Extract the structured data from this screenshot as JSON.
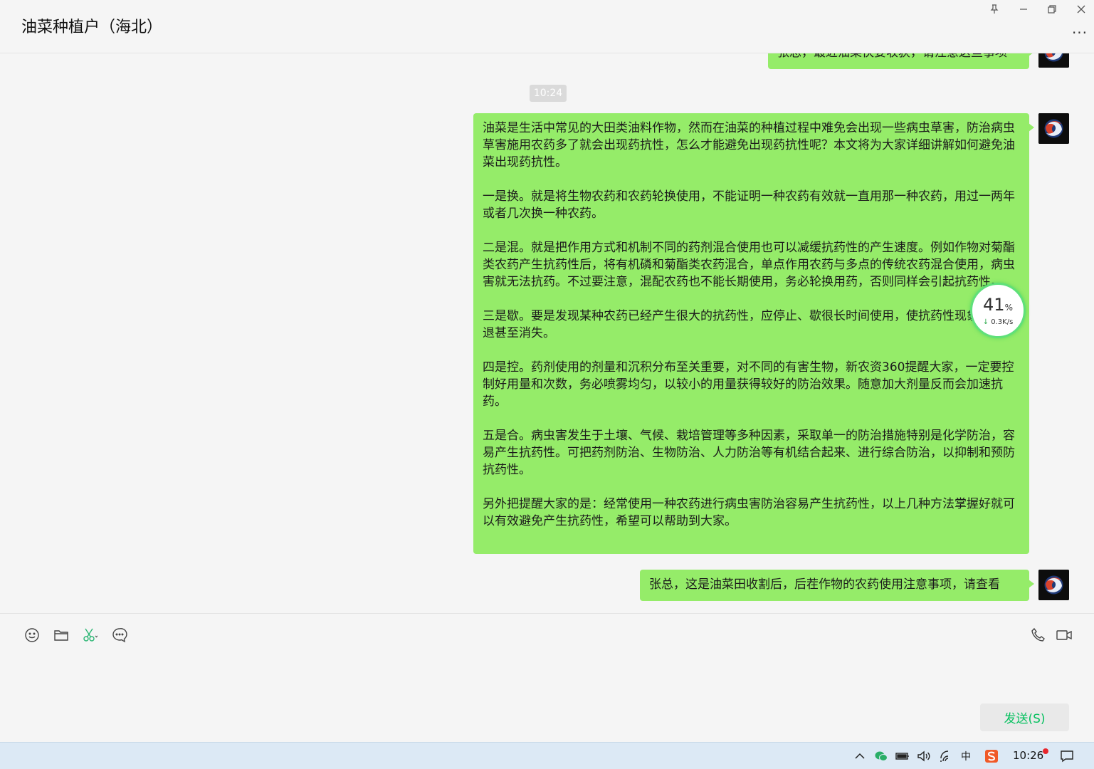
{
  "window": {
    "chat_title": "油菜种植户（海北）",
    "more_label": "···"
  },
  "messages": {
    "partial_top_text": "张总，最近油菜快要收获，请注意这些事项",
    "timestamp": "10:24",
    "long_message": "油菜是生活中常见的大田类油料作物，然而在油菜的种植过程中难免会出现一些病虫草害，防治病虫草害施用农药多了就会出现药抗性，怎么才能避免出现药抗性呢？本文将为大家详细讲解如何避免油菜出现药抗性。\n\n一是换。就是将生物农药和农药轮换使用，不能证明一种农药有效就一直用那一种农药，用过一两年或者几次换一种农药。\n\n二是混。就是把作用方式和机制不同的药剂混合使用也可以减缓抗药性的产生速度。例如作物对菊酯类农药产生抗药性后，将有机磷和菊酯类农药混合，单点作用农药与多点的传统农药混合使用，病虫害就无法抗药。不过要注意，混配农药也不能长期使用，务必轮换用药，否则同样会引起抗药性。\n\n三是歇。要是发现某种农药已经产生很大的抗药性，应停止、歇很长时间使用，使抗药性现象逐渐减退甚至消失。\n\n四是控。药剂使用的剂量和沉积分布至关重要，对不同的有害生物，新农资360提醒大家，一定要控制好用量和次数，务必喷雾均匀，以较小的用量获得较好的防治效果。随意加大剂量反而会加速抗药。\n\n五是合。病虫害发生于土壤、气候、栽培管理等多种因素，采取单一的防治措施特别是化学防治，容易产生抗药性。可把药剂防治、生物防治、人力防治等有机结合起来、进行综合防治，以抑制和预防抗药性。\n\n另外把提醒大家的是：经常使用一种农药进行病虫害防治容易产生抗药性，以上几种方法掌握好就可以有效避免产生抗药性，希望可以帮助到大家。",
    "last_message": "张总，这是油菜田收割后，后茬作物的农药使用注意事项，请查看"
  },
  "speed_widget": {
    "percent": "41",
    "percent_sign": "%",
    "rate": "0.3K/s",
    "arrow": "↓"
  },
  "input": {
    "send_label": "发送(S)"
  },
  "taskbar": {
    "ime_label": "中",
    "clock": "10:26"
  },
  "colors": {
    "bubble": "#95ec69",
    "send_text": "#07c160",
    "accent": "#07c160"
  }
}
